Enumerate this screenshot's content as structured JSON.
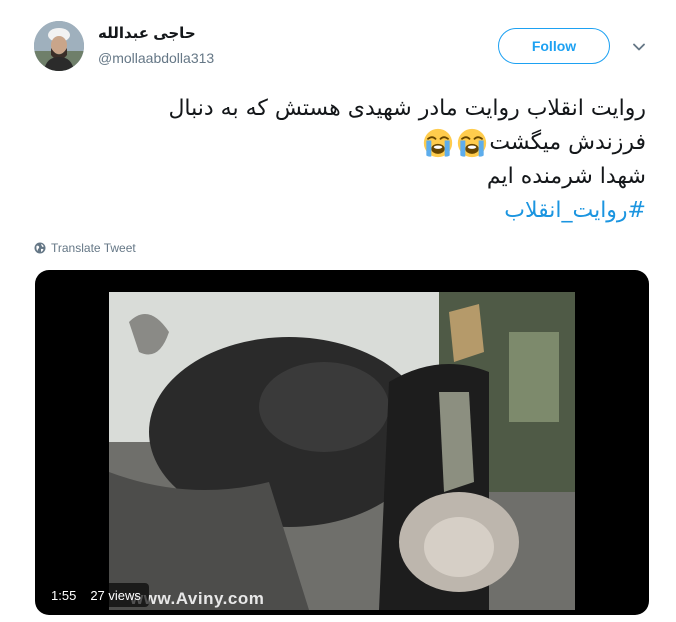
{
  "tweet": {
    "author": {
      "display_name": "حاجی عبدالله",
      "handle": "@mollaabdolla313"
    },
    "follow_label": "Follow",
    "text_lines": [
      "روایت انقلاب روایت مادر شهیدی هستش که به دنبال",
      "فرزندش میگشت",
      "شهدا شرمنده ایم"
    ],
    "emoji": [
      "loudly-crying-face",
      "loudly-crying-face"
    ],
    "hashtag": "#روایت_انقلاب",
    "translate_label": "Translate Tweet"
  },
  "video": {
    "duration": "1:55",
    "views": "27 views",
    "watermark": "www.Aviny.com"
  },
  "colors": {
    "accent": "#1da1f2",
    "hashtag": "#1b95e0",
    "secondary_text": "#657786"
  }
}
